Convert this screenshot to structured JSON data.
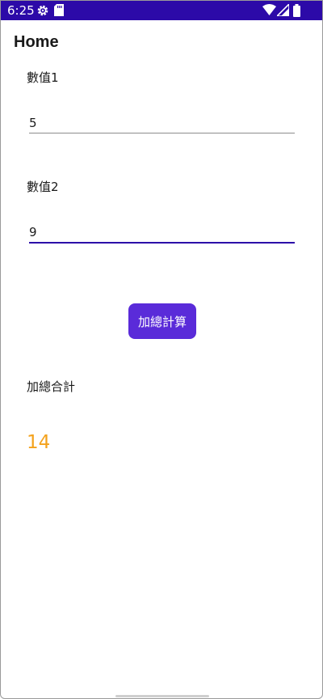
{
  "status_bar": {
    "time": "6:25",
    "background": "#2c0aa8",
    "icons": [
      "gear-icon",
      "sd-card-icon",
      "wifi-icon",
      "cell-signal-icon",
      "battery-icon"
    ]
  },
  "page": {
    "title": "Home"
  },
  "form": {
    "field1": {
      "label": "數值1",
      "value": "5"
    },
    "field2": {
      "label": "數值2",
      "value": "9"
    },
    "button_label": "加總計算",
    "result_label": "加總合計",
    "result_value": "14"
  },
  "colors": {
    "accent": "#5a2bd9",
    "underline_focused": "#2c0aa8",
    "result": "#f4a21c"
  }
}
